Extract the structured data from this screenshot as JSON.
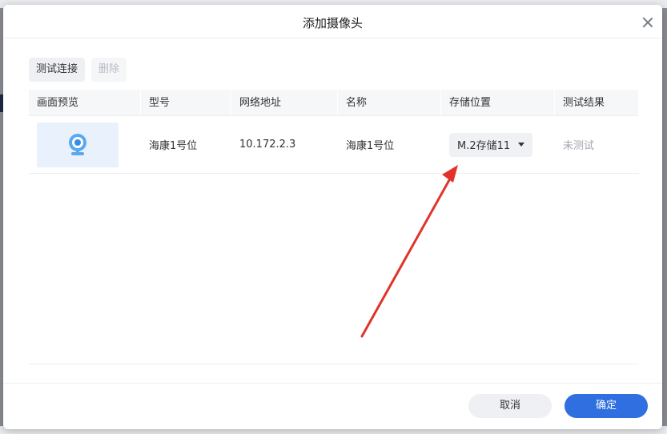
{
  "dialog": {
    "title": "添加摄像头"
  },
  "toolbar": {
    "test_label": "测试连接",
    "delete_label": "删除"
  },
  "table": {
    "headers": [
      "画面预览",
      "型号",
      "网络地址",
      "名称",
      "存储位置",
      "测试结果"
    ],
    "rows": [
      {
        "model": "海康1号位",
        "address": "10.172.2.3",
        "name": "海康1号位",
        "storage": "M.2存储11",
        "result": "未测试"
      }
    ]
  },
  "footer": {
    "cancel_label": "取消",
    "ok_label": "确定"
  },
  "colors": {
    "accent": "#2f6fe0",
    "annotation_arrow": "#e0342a",
    "preview_bg": "#e9f2fc"
  },
  "icons": {
    "close": "close-icon",
    "camera": "camera-icon",
    "dropdown": "caret-down-icon"
  }
}
